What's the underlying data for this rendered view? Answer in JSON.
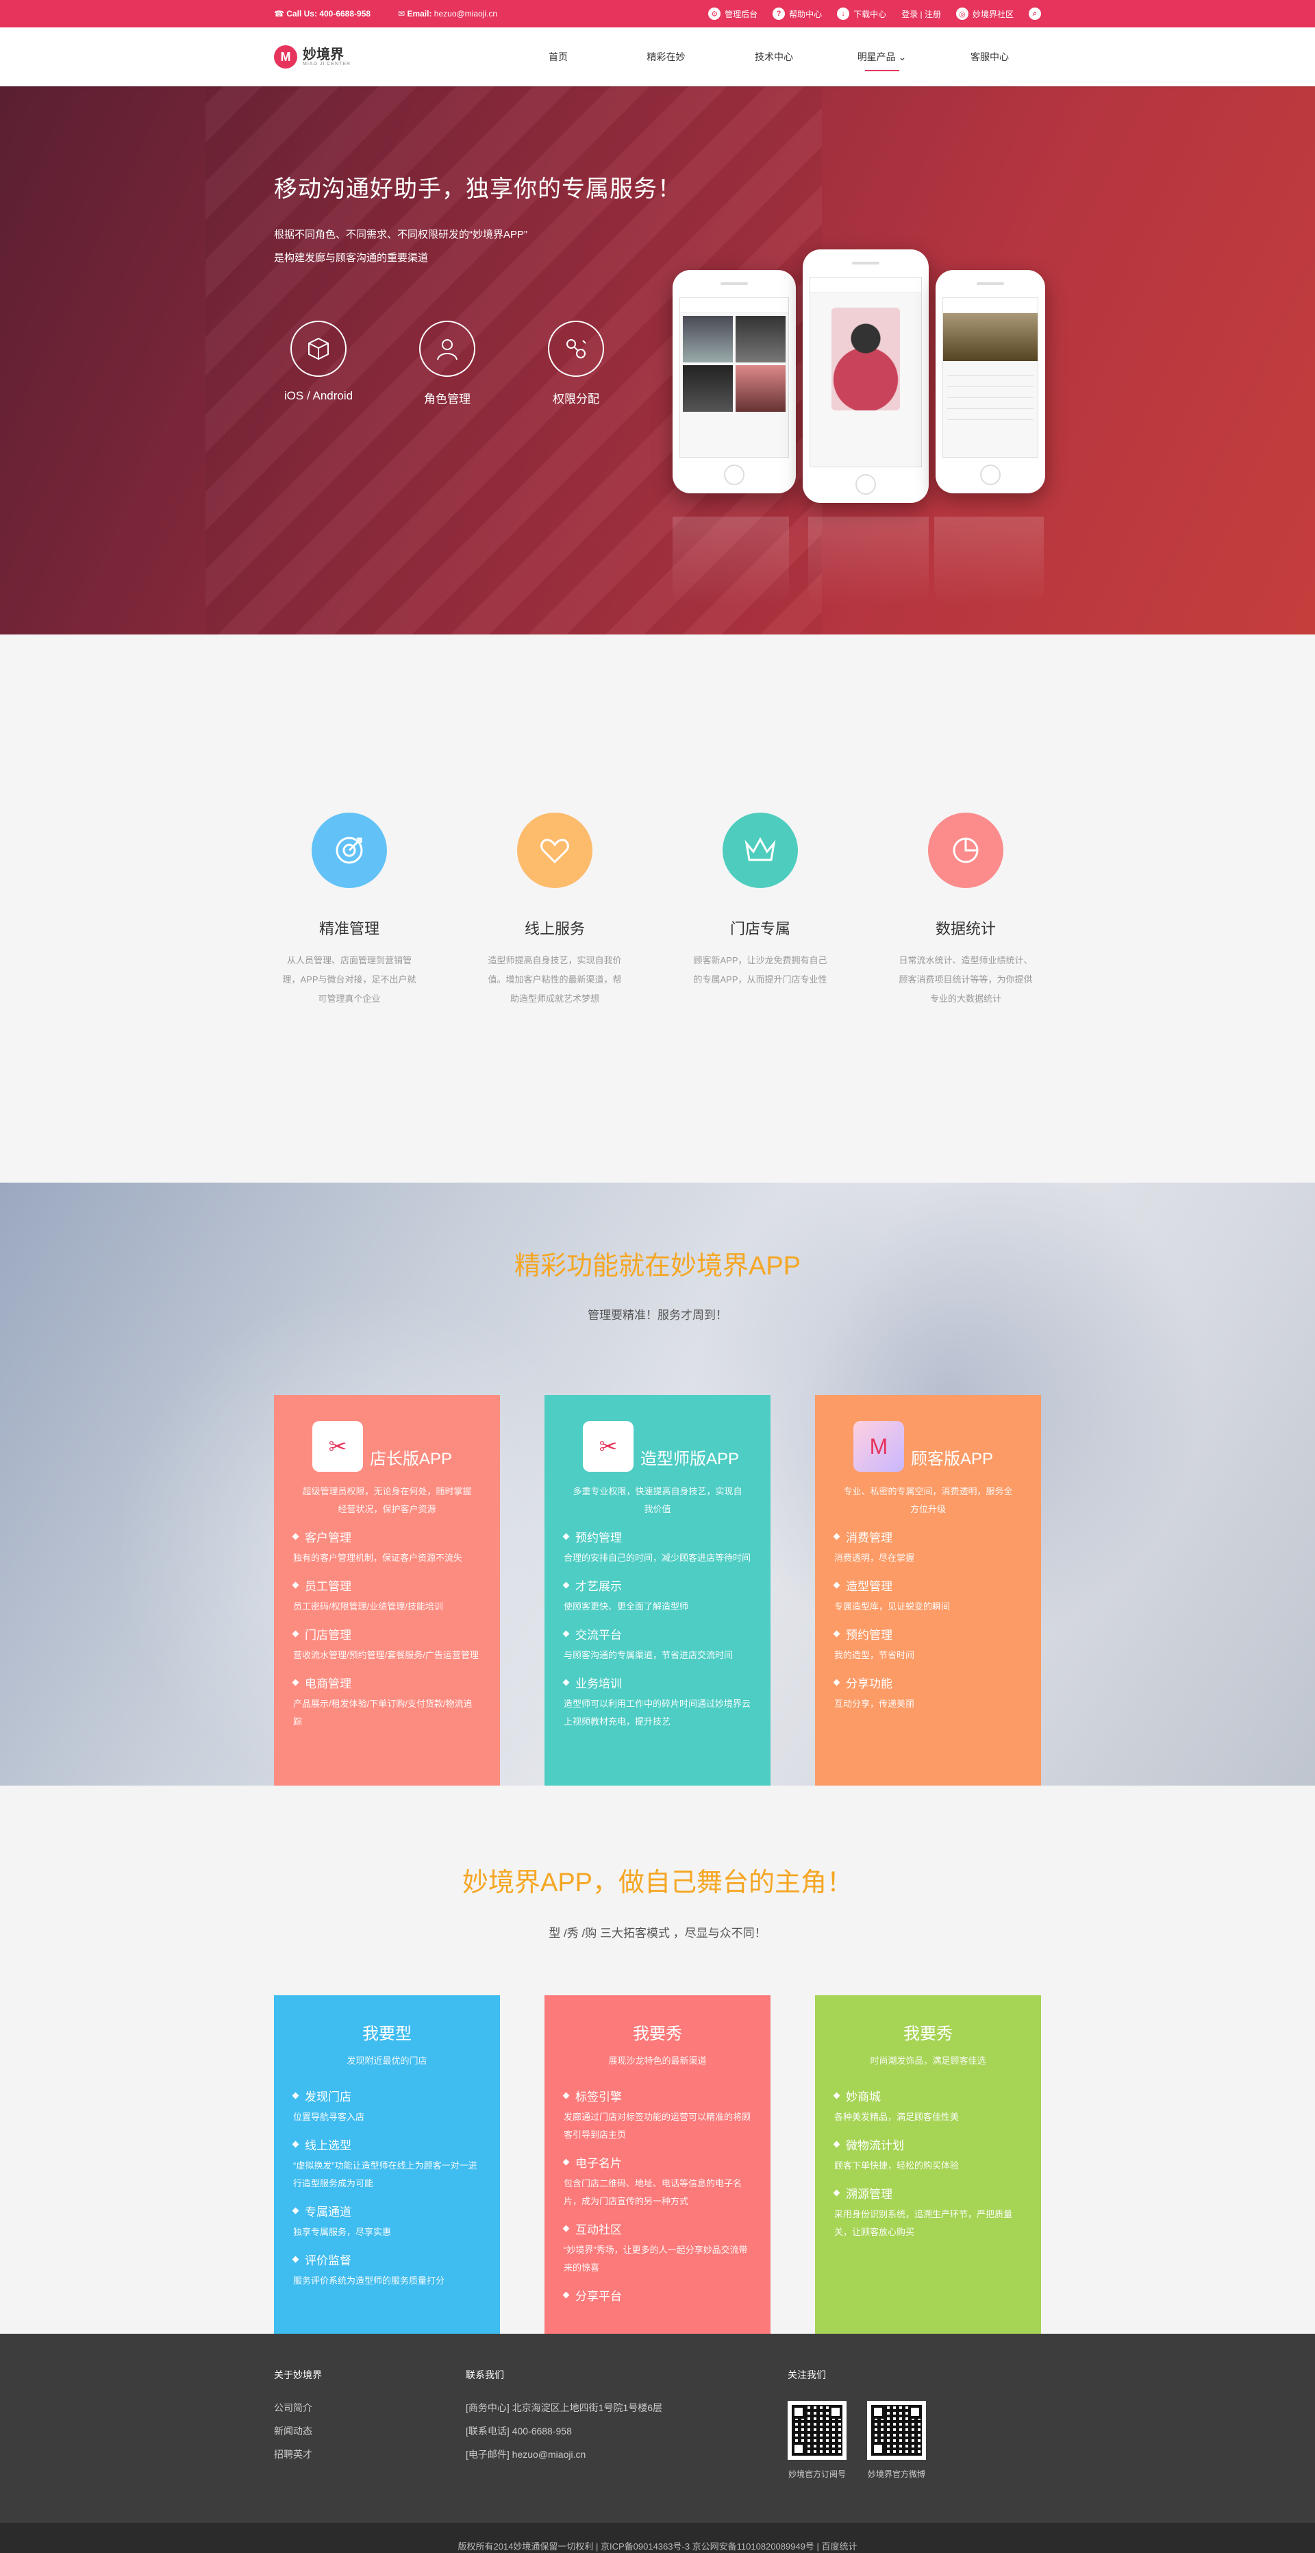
{
  "topbar": {
    "call_label": "Call Us:",
    "phone": "400-6688-958",
    "email_label": "Email:",
    "email": "hezuo@miaoji.cn",
    "links": [
      "管理后台",
      "帮助中心",
      "下载中心"
    ],
    "login": "登录 | 注册",
    "community": "妙境界社区"
  },
  "nav": {
    "logo_text": "妙境界",
    "logo_sub": "MIAO JI CENTER",
    "items": [
      "首页",
      "精彩在妙",
      "技术中心",
      "明星产品",
      "客服中心"
    ]
  },
  "hero": {
    "title": "移动沟通好助手，独享你的专属服务！",
    "desc_line1": "根据不同角色、不同需求、不同权限研发的“妙境界APP”",
    "desc_line2": "是构建发廊与顾客沟通的重要渠道",
    "features": [
      "iOS / Android",
      "角色管理",
      "权限分配"
    ]
  },
  "features": [
    {
      "title": "精准管理",
      "desc": "从人员管理、店面管理到营销管理，APP与微台对接，足不出户就可管理真个企业",
      "color": "#62c2f7",
      "icon": "target-icon"
    },
    {
      "title": "线上服务",
      "desc": "造型师提高自身技艺，实现自我价值。增加客户粘性的最新渠道，帮助造型师成就艺术梦想",
      "color": "#fdbb6c",
      "icon": "heart-icon"
    },
    {
      "title": "门店专属",
      "desc": "顾客新APP，让沙龙免费拥有自己的专属APP，从而提升门店专业性",
      "color": "#4ecdbf",
      "icon": "crown-icon"
    },
    {
      "title": "数据统计",
      "desc": "日常流水统计、造型师业绩统计、顾客消费项目统计等等，为你提供专业的大数据统计",
      "color": "#fc8c8c",
      "icon": "piechart-icon"
    }
  ],
  "apps": {
    "title": "精彩功能就在妙境界APP",
    "subtitle": "管理要精准！服务才周到！",
    "cards": [
      {
        "title": "店长版APP",
        "color": "#fd8c80",
        "icon": "boss-icon",
        "desc": "超级管理员权限，无论身在何处，随时掌握经营状况，保护客户资源",
        "items": [
          {
            "h": "客户管理",
            "d": "独有的客户管理机制，保证客户资源不流失"
          },
          {
            "h": "员工管理",
            "d": "员工密码/权限管理/业绩管理/技能培训"
          },
          {
            "h": "门店管理",
            "d": "营收流水管理/预约管理/套餐服务/广告运营管理"
          },
          {
            "h": "电商管理",
            "d": "产品展示/租发体验/下单订购/支付货款/物流追踪"
          }
        ]
      },
      {
        "title": "造型师版APP",
        "color": "#4ecdc4",
        "icon": "scissors-icon",
        "desc": "多重专业权限，快速提高自身技艺，实现自我价值",
        "items": [
          {
            "h": "预约管理",
            "d": "合理的安排自己的时间，减少顾客进店等待时间"
          },
          {
            "h": "才艺展示",
            "d": "使顾客更快、更全面了解造型师"
          },
          {
            "h": "交流平台",
            "d": "与顾客沟通的专属渠道，节省进店交流时间"
          },
          {
            "h": "业务培训",
            "d": "造型师可以利用工作中的碎片时间通过妙境界云上视频教材充电，提升技艺"
          }
        ]
      },
      {
        "title": "顾客版APP",
        "color": "#fc9b66",
        "icon": "miaojie-icon",
        "desc": "专业、私密的专属空间，消费透明，服务全方位升级",
        "items": [
          {
            "h": "消费管理",
            "d": "消费透明，尽在掌握"
          },
          {
            "h": "造型管理",
            "d": "专属造型库，见证蜕变的瞬间"
          },
          {
            "h": "预约管理",
            "d": "我的造型，节省时间"
          },
          {
            "h": "分享功能",
            "d": "互动分享，传递美丽"
          }
        ]
      }
    ]
  },
  "modes": {
    "title": "妙境界APP，做自己舞台的主角！",
    "subtitle": "型 /秀 /购  三大拓客模式 ，尽显与众不同！",
    "cards": [
      {
        "title": "我要型",
        "sub": "发现附近最优的门店",
        "color": "#3fbcf0",
        "items": [
          {
            "h": "发现门店",
            "d": "位置导航寻客入店"
          },
          {
            "h": "线上选型",
            "d": "“虚拟换发”功能让造型师在线上为顾客一对一进行造型服务成为可能"
          },
          {
            "h": "专属通道",
            "d": "独享专属服务，尽享实惠"
          },
          {
            "h": "评价监督",
            "d": "服务评价系统为造型师的服务质量打分"
          }
        ]
      },
      {
        "title": "我要秀",
        "sub": "展现沙龙特色的最新渠道",
        "color": "#fc7a7a",
        "items": [
          {
            "h": "标签引擎",
            "d": "发廊通过门店对标签功能的运营可以精准的将顾客引导到店主页"
          },
          {
            "h": "电子名片",
            "d": "包含门店二维码、地址、电话等信息的电子名片，成为门店宣传的另一种方式"
          },
          {
            "h": "互动社区",
            "d": "“妙境界”秀场，让更多的人一起分享妙品交流带来的惊喜"
          },
          {
            "h": "分享平台",
            "d": ""
          }
        ]
      },
      {
        "title": "我要秀",
        "sub": "时尚潮发饰品，满足顾客佳选",
        "color": "#a6d455",
        "items": [
          {
            "h": "妙商城",
            "d": "各种美发精品，满足顾客佳性美"
          },
          {
            "h": "微物流计划",
            "d": "顾客下单快捷，轻松的购买体验"
          },
          {
            "h": "溯源管理",
            "d": "采用身份识别系统，追溯生产环节，严把质量关，让顾客放心购买"
          }
        ]
      }
    ]
  },
  "footer": {
    "about_title": "关于妙境界",
    "about_links": [
      "公司简介",
      "新闻动态",
      "招聘英才"
    ],
    "contact_title": "联系我们",
    "contact_lines": [
      "[商务中心] 北京海淀区上地四街1号院1号楼6层",
      "[联系电话] 400-6688-958",
      "[电子邮件] hezuo@miaoji.cn"
    ],
    "follow_title": "关注我们",
    "qr_labels": [
      "妙境官方订阅号",
      "妙境界官方微博"
    ],
    "copyright": "版权所有2014妙境通保留一切权利  |  京ICP备09014363号-3 京公网安备11010820089949号  |  百度统计"
  }
}
